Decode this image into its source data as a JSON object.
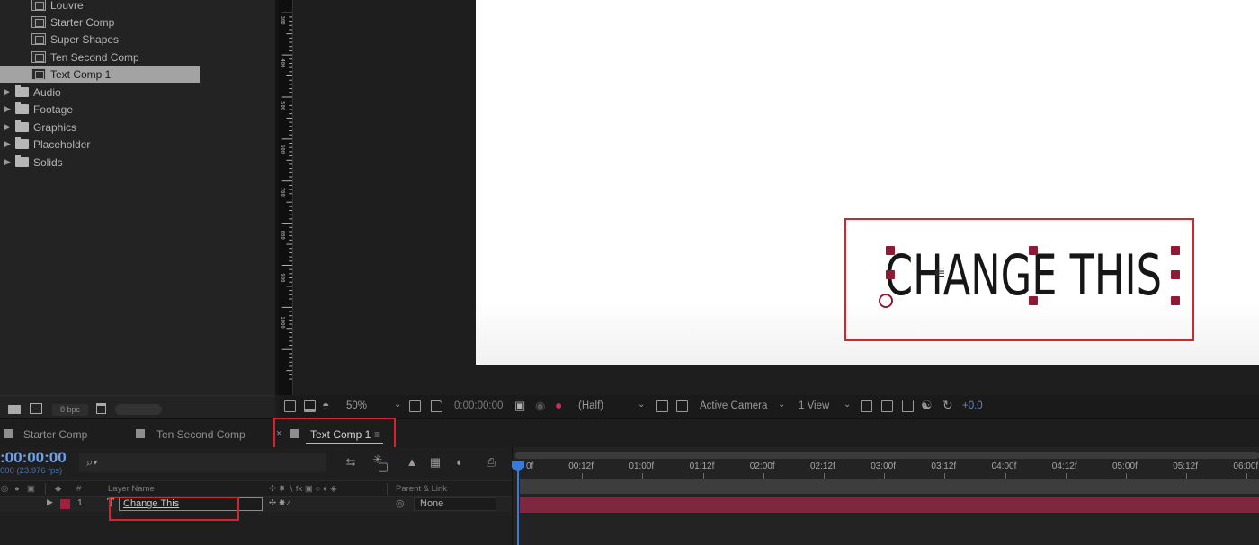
{
  "project": {
    "items": [
      {
        "label": "Louvre",
        "kind": "comp"
      },
      {
        "label": "Starter Comp",
        "kind": "comp"
      },
      {
        "label": "Super Shapes",
        "kind": "comp"
      },
      {
        "label": "Ten Second Comp",
        "kind": "comp"
      },
      {
        "label": "Text Comp 1",
        "kind": "comp",
        "selected": true
      },
      {
        "label": "Audio",
        "kind": "folder"
      },
      {
        "label": "Footage",
        "kind": "folder"
      },
      {
        "label": "Graphics",
        "kind": "folder"
      },
      {
        "label": "Placeholder",
        "kind": "folder"
      },
      {
        "label": "Solids",
        "kind": "folder"
      }
    ],
    "footer": {
      "bit_depth": "8 bpc"
    }
  },
  "viewer": {
    "canvas_text": "CHANGE THIS",
    "ruler_labels": [
      "300",
      "400",
      "500",
      "600",
      "700",
      "800",
      "900",
      "1000"
    ],
    "toolbar": {
      "zoom": "50%",
      "timecode": "0:00:00:00",
      "resolution": "(Half)",
      "camera": "Active Camera",
      "views": "1 View",
      "exposure": "+0.0"
    }
  },
  "timeline": {
    "tabs": [
      {
        "label": "Starter Comp",
        "active": false
      },
      {
        "label": "Ten Second Comp",
        "active": false
      },
      {
        "label": "Text Comp 1",
        "active": true
      }
    ],
    "close_glyph": "×",
    "menu_glyph": "≡",
    "current_time": ":00:00:00",
    "fps": "000 (23.976 fps)",
    "search_placeholder": "⌕▾",
    "columns": {
      "num": "#",
      "layer_name": "Layer Name",
      "parent": "Parent & Link"
    },
    "layers": [
      {
        "num": "1",
        "type_glyph": "T",
        "name": "Change This",
        "parent": "None"
      }
    ],
    "time_ticks": [
      "0f",
      "00:12f",
      "01:00f",
      "01:12f",
      "02:00f",
      "02:12f",
      "03:00f",
      "03:12f",
      "04:00f",
      "04:12f",
      "05:00f",
      "05:12f",
      "06:00f"
    ]
  },
  "colors": {
    "accent_blue": "#3a7ad6",
    "layer_label": "#a0203e",
    "callout": "#d6242f"
  }
}
